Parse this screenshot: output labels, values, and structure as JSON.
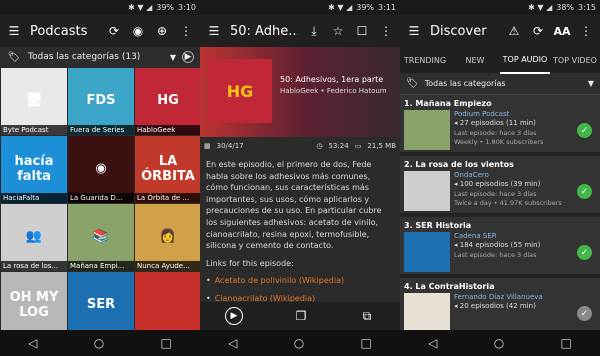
{
  "p1": {
    "status": {
      "signal": "✱ ▼ ◢",
      "battery": "39%",
      "time": "3:10"
    },
    "title": "Podcasts",
    "category": "Todas las categorías (13)",
    "tiles": [
      {
        "label": "Byte Podcast",
        "art": "🖥",
        "color": "#e9e9e9"
      },
      {
        "label": "Fuera de Series",
        "art": "FDS",
        "color": "#3ba6c8"
      },
      {
        "label": "HabloGeek",
        "art": "HG",
        "color": "#c02838"
      },
      {
        "label": "HaciaFalta",
        "art": "hacía falta",
        "color": "#1d8fd8"
      },
      {
        "label": "La Guarida D...",
        "art": "◉",
        "color": "#3a1010"
      },
      {
        "label": "La Órbita de ...",
        "art": "LA ÓRBITA",
        "color": "#c0392b"
      },
      {
        "label": "La rosa de los...",
        "art": "👥",
        "color": "#cfcfcf"
      },
      {
        "label": "Mañana Empi...",
        "art": "📚",
        "color": "#8aa36a"
      },
      {
        "label": "Nunca Ayude...",
        "art": "👩",
        "color": "#d1a14a"
      },
      {
        "label": "",
        "art": "OH MY LOG",
        "color": "#b8b8b8"
      },
      {
        "label": "",
        "art": "SER",
        "color": "#1c6fb0"
      },
      {
        "label": "",
        "art": "",
        "color": "#c9302c"
      }
    ]
  },
  "p2": {
    "status": {
      "signal": "✱ ▼ ◢",
      "battery": "39%",
      "time": "3:11"
    },
    "title": "50: Adhe...",
    "hero": {
      "thumb": "HG",
      "episode": "50: Adhesivos, 1era parte",
      "author": "HabloGeek • Federico Hatoum"
    },
    "date": "30/4/17",
    "duration": "53:24",
    "size": "21,5 MB",
    "description": "En este episodio, el primero de dos, Fede habla sobre los adhesivos más comunes, cómo funcionan, sus características más importantes, sus usos, cómo aplicarlos y precauciones de su uso. En particular cubre los siguientes adhesivos: acetato de vinilo, cianoacrilato, resina epoxi, termofusible, silicona y cemento de contacto.",
    "links_label": "Links for this episode:",
    "links": [
      "Acetato de polivinilo (Wikipedia)",
      "Cianoacrilato (Wikipedia)"
    ]
  },
  "p3": {
    "status": {
      "signal": "✱ ▼ ◢",
      "battery": "38%",
      "time": "3:15"
    },
    "title": "Discover",
    "tabs": [
      "TRENDING",
      "NEW",
      "TOP AUDIO",
      "TOP VIDEO"
    ],
    "active_tab": "TOP AUDIO",
    "category": "Todas las categorías",
    "entries": [
      {
        "head": "1. Mañana Empiezo",
        "name": "Podium Podcast",
        "count": "27 episodios (11 min)",
        "l1": "Last episode: hace 3 días",
        "l2": "Weekly • 1.80K subscribers",
        "color": "#8aa36a"
      },
      {
        "head": "2. La rosa de los vientos",
        "name": "OndaCero",
        "count": "100 episodios (39 min)",
        "l1": "Last episode: hace 3 días",
        "l2": "Twice a day • 41.97K subscribers",
        "color": "#cfcfcf"
      },
      {
        "head": "3. SER Historia",
        "name": "Cadena SER",
        "count": "184 episodios (55 min)",
        "l1": "Last episode: hace 3 días",
        "l2": "",
        "color": "#1c6fb0"
      },
      {
        "head": "4. La ContraHistoria",
        "name": "Fernando Díaz Villanueva",
        "count": "20 episodios (42 min)",
        "l1": "",
        "l2": "",
        "color": "#e8e2d6"
      }
    ]
  }
}
